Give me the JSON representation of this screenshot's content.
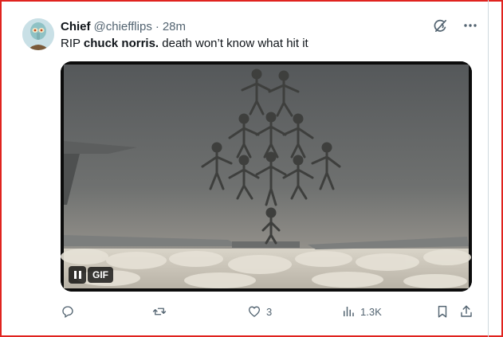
{
  "tweet": {
    "author_name": "Chief",
    "handle": "@chiefflips",
    "separator": "·",
    "time": "28m",
    "text_prefix": "RIP ",
    "text_bold": "chuck norris.",
    "text_suffix": " death won’t know what hit it",
    "gif_label": "GIF"
  },
  "header_icons": [
    "grok-icon",
    "more-icon"
  ],
  "actions": {
    "reply_count": "",
    "retweet_count": "",
    "like_count": "3",
    "views_count": "1.3K"
  },
  "colors": {
    "text_primary": "#0f1419",
    "text_secondary": "#536471",
    "border_accent": "#e0231f"
  }
}
